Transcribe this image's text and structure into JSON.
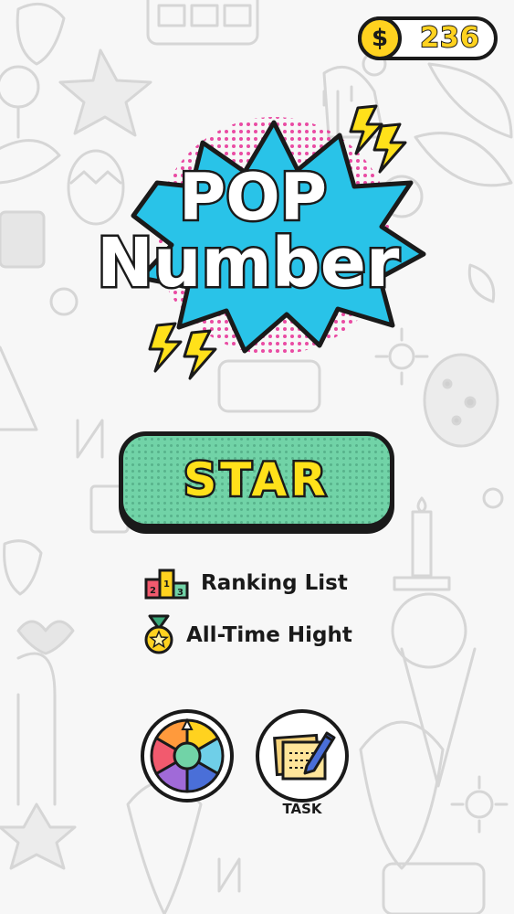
{
  "currency": {
    "symbol": "$",
    "amount": "236"
  },
  "logo": {
    "line1": "POP",
    "line2": "Number"
  },
  "start_button": {
    "label": "STAR"
  },
  "menu": {
    "ranking_label": "Ranking List",
    "ranking_podium_digits": [
      "2",
      "1",
      "3"
    ],
    "alltime_label": "All-Time Hight"
  },
  "buttons": {
    "task_label": "TASK"
  },
  "colors": {
    "coin_yellow": "#ffd21f",
    "start_green": "#71d3a7",
    "start_text": "#ffe11a",
    "burst_blue": "#29c3e8",
    "halftone_pink": "#e8389a",
    "outline": "#1a1a1a"
  },
  "icons": [
    "dollar-coin-icon",
    "podium-icon",
    "medal-icon",
    "color-wheel-icon",
    "task-note-icon",
    "lightning-icon"
  ]
}
